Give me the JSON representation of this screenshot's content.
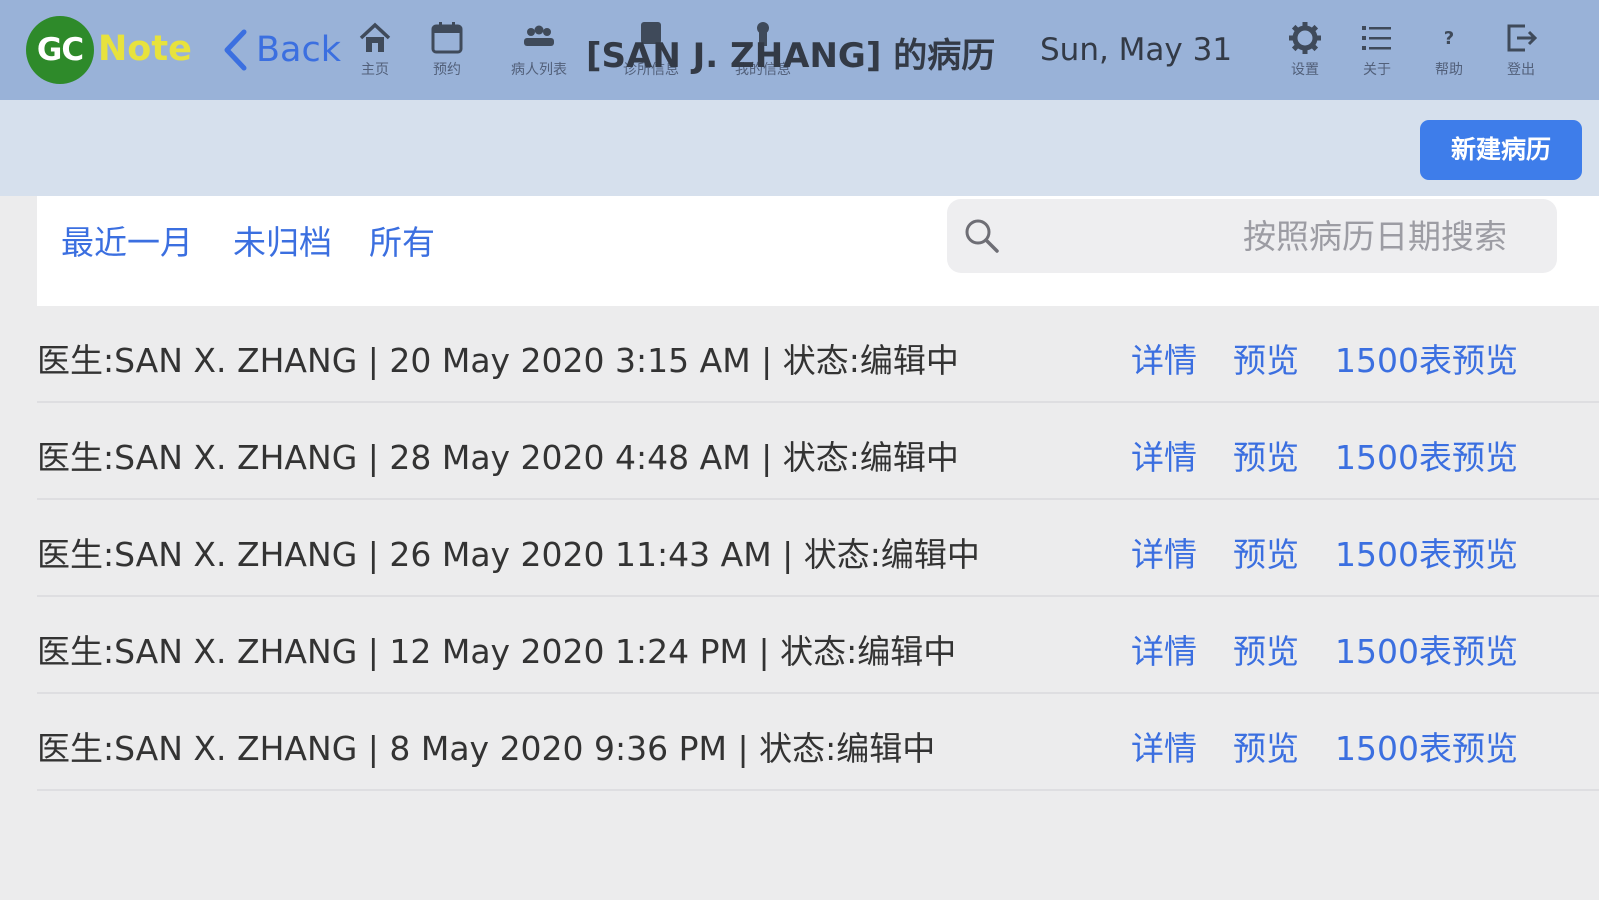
{
  "app": {
    "logo_gc": "GC",
    "logo_note": "Note"
  },
  "nav": {
    "back_label": "Back",
    "icons": [
      {
        "name": "home-icon",
        "label": "主页"
      },
      {
        "name": "calendar-icon",
        "label": "预约"
      },
      {
        "name": "patients-icon",
        "label": "病人列表"
      },
      {
        "name": "clinic-info-icon",
        "label": "诊所信息"
      },
      {
        "name": "my-info-icon",
        "label": "我的信息"
      },
      {
        "name": "gear-icon",
        "label": "设置"
      },
      {
        "name": "list-icon",
        "label": "关于"
      },
      {
        "name": "help-icon",
        "label": "帮助"
      },
      {
        "name": "logout-icon",
        "label": "登出"
      }
    ],
    "page_title": "[SAN J. ZHANG] 的病历",
    "date": "Sun, May 31"
  },
  "toolbar": {
    "new_record_label": "新建病历"
  },
  "filters": [
    "最近一月",
    "未归档",
    "所有"
  ],
  "search": {
    "placeholder": "按照病历日期搜索",
    "value": ""
  },
  "records": [
    {
      "text": "医生:SAN X. ZHANG | 20 May 2020 3:15 AM | 状态:编辑中"
    },
    {
      "text": "医生:SAN X. ZHANG | 28 May 2020 4:48 AM | 状态:编辑中"
    },
    {
      "text": "医生:SAN X. ZHANG | 26 May 2020 11:43 AM | 状态:编辑中"
    },
    {
      "text": "医生:SAN X. ZHANG | 12 May 2020 1:24 PM | 状态:编辑中"
    },
    {
      "text": "医生:SAN X. ZHANG | 8 May 2020 9:36 PM | 状态:编辑中"
    }
  ],
  "record_actions": {
    "details": "详情",
    "preview": "预览",
    "form_preview": "1500表预览"
  },
  "colors": {
    "navbar": "#99b2d8",
    "subheader": "#d6e0ed",
    "accent": "#3b6fe0",
    "button": "#3e7dea",
    "logo_green": "#2e8a2a",
    "logo_yellow": "#e7e23d"
  }
}
